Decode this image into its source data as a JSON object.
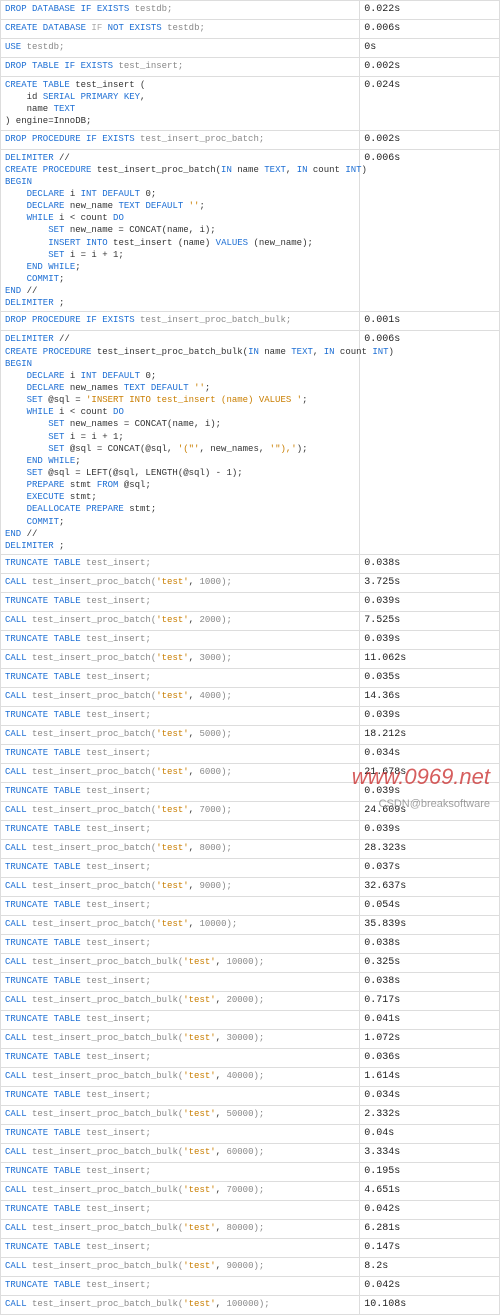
{
  "rows": [
    {
      "sql": "<span class='kw'>DROP DATABASE IF EXISTS</span> <span class='fn'>testdb;</span>",
      "time": "0.022s"
    },
    {
      "sql": "<span class='kw'>CREATE DATABASE</span> <span class='cm'>IF</span> <span class='kw'>NOT EXISTS</span> <span class='fn'>testdb;</span>",
      "time": "0.006s"
    },
    {
      "sql": "<span class='kw'>USE</span> <span class='fn'>testdb;</span>",
      "time": "0s"
    },
    {
      "sql": "<span class='kw'>DROP TABLE IF EXISTS</span> <span class='fn'>test_insert;</span>",
      "time": "0.002s"
    },
    {
      "sql": "<pre><span class='kw'>CREATE TABLE</span> test_insert (\n    id <span class='kw'>SERIAL PRIMARY KEY</span>,\n    name <span class='kw'>TEXT</span>\n) engine=InnoDB;</pre>",
      "time": "0.024s"
    },
    {
      "sql": "<span class='kw'>DROP PROCEDURE IF EXISTS</span> <span class='fn'>test_insert_proc_batch;</span>",
      "time": "0.002s"
    },
    {
      "sql": "<pre><span class='kw'>DELIMITER</span> //\n<span class='kw'>CREATE PROCEDURE</span> test_insert_proc_batch(<span class='kw'>IN</span> name <span class='kw'>TEXT</span>, <span class='kw'>IN</span> count <span class='kw'>INT</span>)\n<span class='kw'>BEGIN</span>\n    <span class='kw'>DECLARE</span> i <span class='kw'>INT DEFAULT</span> 0;\n    <span class='kw'>DECLARE</span> new_name <span class='kw'>TEXT DEFAULT</span> <span class='lit'>''</span>;\n    <span class='kw'>WHILE</span> i &lt; count <span class='kw'>DO</span>\n        <span class='kw'>SET</span> new_name = CONCAT(name, i);\n        <span class='kw'>INSERT INTO</span> test_insert (name) <span class='kw'>VALUES</span> (new_name);\n        <span class='kw'>SET</span> i = i + 1;\n    <span class='kw'>END WHILE</span>;\n    <span class='kw'>COMMIT</span>;\n<span class='kw'>END</span> //\n<span class='kw'>DELIMITER</span> ;</pre>",
      "time": "0.006s"
    },
    {
      "sql": "<span class='kw'>DROP PROCEDURE IF EXISTS</span> <span class='fn'>test_insert_proc_batch_bulk;</span>",
      "time": "0.001s"
    },
    {
      "sql": "<pre><span class='kw'>DELIMITER</span> //\n<span class='kw'>CREATE PROCEDURE</span> test_insert_proc_batch_bulk(<span class='kw'>IN</span> name <span class='kw'>TEXT</span>, <span class='kw'>IN</span> count <span class='kw'>INT</span>)\n<span class='kw'>BEGIN</span>\n    <span class='kw'>DECLARE</span> i <span class='kw'>INT DEFAULT</span> 0;\n    <span class='kw'>DECLARE</span> new_names <span class='kw'>TEXT DEFAULT</span> <span class='lit'>''</span>;\n    <span class='kw'>SET</span> @sql = <span class='lit'>'INSERT INTO test_insert (name) VALUES '</span>;\n    <span class='kw'>WHILE</span> i &lt; count <span class='kw'>DO</span>\n        <span class='kw'>SET</span> new_names = CONCAT(name, i);\n        <span class='kw'>SET</span> i = i + 1;\n        <span class='kw'>SET</span> @sql = CONCAT(@sql, <span class='lit'>'(\"'</span>, new_names, <span class='lit'>'\"),'</span>);\n    <span class='kw'>END WHILE</span>;\n    <span class='kw'>SET</span> @sql = LEFT(@sql, LENGTH(@sql) - 1);\n    <span class='kw'>PREPARE</span> stmt <span class='kw'>FROM</span> @sql;\n    <span class='kw'>EXECUTE</span> stmt;\n    <span class='kw'>DEALLOCATE PREPARE</span> stmt;\n    <span class='kw'>COMMIT</span>;\n<span class='kw'>END</span> //\n<span class='kw'>DELIMITER</span> ;</pre>",
      "time": "0.006s"
    },
    {
      "sql": "<span class='kw'>TRUNCATE TABLE</span> <span class='fn'>test_insert;</span>",
      "time": "0.038s"
    },
    {
      "sql": "<span class='kw'>CALL</span> <span class='fn'>test_insert_proc_batch(</span><span class='lit'>'test'</span>, <span class='fn'>1000);</span>",
      "time": "3.725s"
    },
    {
      "sql": "<span class='kw'>TRUNCATE TABLE</span> <span class='fn'>test_insert;</span>",
      "time": "0.039s"
    },
    {
      "sql": "<span class='kw'>CALL</span> <span class='fn'>test_insert_proc_batch(</span><span class='lit'>'test'</span>, <span class='fn'>2000);</span>",
      "time": "7.525s"
    },
    {
      "sql": "<span class='kw'>TRUNCATE TABLE</span> <span class='fn'>test_insert;</span>",
      "time": "0.039s"
    },
    {
      "sql": "<span class='kw'>CALL</span> <span class='fn'>test_insert_proc_batch(</span><span class='lit'>'test'</span>, <span class='fn'>3000);</span>",
      "time": "11.062s"
    },
    {
      "sql": "<span class='kw'>TRUNCATE TABLE</span> <span class='fn'>test_insert;</span>",
      "time": "0.035s"
    },
    {
      "sql": "<span class='kw'>CALL</span> <span class='fn'>test_insert_proc_batch(</span><span class='lit'>'test'</span>, <span class='fn'>4000);</span>",
      "time": "14.36s"
    },
    {
      "sql": "<span class='kw'>TRUNCATE TABLE</span> <span class='fn'>test_insert;</span>",
      "time": "0.039s"
    },
    {
      "sql": "<span class='kw'>CALL</span> <span class='fn'>test_insert_proc_batch(</span><span class='lit'>'test'</span>, <span class='fn'>5000);</span>",
      "time": "18.212s"
    },
    {
      "sql": "<span class='kw'>TRUNCATE TABLE</span> <span class='fn'>test_insert;</span>",
      "time": "0.034s"
    },
    {
      "sql": "<span class='kw'>CALL</span> <span class='fn'>test_insert_proc_batch(</span><span class='lit'>'test'</span>, <span class='fn'>6000);</span>",
      "time": "21.678s"
    },
    {
      "sql": "<span class='kw'>TRUNCATE TABLE</span> <span class='fn'>test_insert;</span>",
      "time": "0.039s"
    },
    {
      "sql": "<span class='kw'>CALL</span> <span class='fn'>test_insert_proc_batch(</span><span class='lit'>'test'</span>, <span class='fn'>7000);</span>",
      "time": "24.609s"
    },
    {
      "sql": "<span class='kw'>TRUNCATE TABLE</span> <span class='fn'>test_insert;</span>",
      "time": "0.039s"
    },
    {
      "sql": "<span class='kw'>CALL</span> <span class='fn'>test_insert_proc_batch(</span><span class='lit'>'test'</span>, <span class='fn'>8000);</span>",
      "time": "28.323s"
    },
    {
      "sql": "<span class='kw'>TRUNCATE TABLE</span> <span class='fn'>test_insert;</span>",
      "time": "0.037s"
    },
    {
      "sql": "<span class='kw'>CALL</span> <span class='fn'>test_insert_proc_batch(</span><span class='lit'>'test'</span>, <span class='fn'>9000);</span>",
      "time": "32.637s"
    },
    {
      "sql": "<span class='kw'>TRUNCATE TABLE</span> <span class='fn'>test_insert;</span>",
      "time": "0.054s"
    },
    {
      "sql": "<span class='kw'>CALL</span> <span class='fn'>test_insert_proc_batch(</span><span class='lit'>'test'</span>, <span class='fn'>10000);</span>",
      "time": "35.839s"
    },
    {
      "sql": "<span class='kw'>TRUNCATE TABLE</span> <span class='fn'>test_insert;</span>",
      "time": "0.038s"
    },
    {
      "sql": "<span class='kw'>CALL</span> <span class='fn'>test_insert_proc_batch_bulk(</span><span class='lit'>'test'</span>, <span class='fn'>10000);</span>",
      "time": "0.325s"
    },
    {
      "sql": "<span class='kw'>TRUNCATE TABLE</span> <span class='fn'>test_insert;</span>",
      "time": "0.038s"
    },
    {
      "sql": "<span class='kw'>CALL</span> <span class='fn'>test_insert_proc_batch_bulk(</span><span class='lit'>'test'</span>, <span class='fn'>20000);</span>",
      "time": "0.717s"
    },
    {
      "sql": "<span class='kw'>TRUNCATE TABLE</span> <span class='fn'>test_insert;</span>",
      "time": "0.041s"
    },
    {
      "sql": "<span class='kw'>CALL</span> <span class='fn'>test_insert_proc_batch_bulk(</span><span class='lit'>'test'</span>, <span class='fn'>30000);</span>",
      "time": "1.072s"
    },
    {
      "sql": "<span class='kw'>TRUNCATE TABLE</span> <span class='fn'>test_insert;</span>",
      "time": "0.036s"
    },
    {
      "sql": "<span class='kw'>CALL</span> <span class='fn'>test_insert_proc_batch_bulk(</span><span class='lit'>'test'</span>, <span class='fn'>40000);</span>",
      "time": "1.614s"
    },
    {
      "sql": "<span class='kw'>TRUNCATE TABLE</span> <span class='fn'>test_insert;</span>",
      "time": "0.034s"
    },
    {
      "sql": "<span class='kw'>CALL</span> <span class='fn'>test_insert_proc_batch_bulk(</span><span class='lit'>'test'</span>, <span class='fn'>50000);</span>",
      "time": "2.332s"
    },
    {
      "sql": "<span class='kw'>TRUNCATE TABLE</span> <span class='fn'>test_insert;</span>",
      "time": "0.04s"
    },
    {
      "sql": "<span class='kw'>CALL</span> <span class='fn'>test_insert_proc_batch_bulk(</span><span class='lit'>'test'</span>, <span class='fn'>60000);</span>",
      "time": "3.334s"
    },
    {
      "sql": "<span class='kw'>TRUNCATE TABLE</span> <span class='fn'>test_insert;</span>",
      "time": "0.195s"
    },
    {
      "sql": "<span class='kw'>CALL</span> <span class='fn'>test_insert_proc_batch_bulk(</span><span class='lit'>'test'</span>, <span class='fn'>70000);</span>",
      "time": "4.651s"
    },
    {
      "sql": "<span class='kw'>TRUNCATE TABLE</span> <span class='fn'>test_insert;</span>",
      "time": "0.042s"
    },
    {
      "sql": "<span class='kw'>CALL</span> <span class='fn'>test_insert_proc_batch_bulk(</span><span class='lit'>'test'</span>, <span class='fn'>80000);</span>",
      "time": "6.281s"
    },
    {
      "sql": "<span class='kw'>TRUNCATE TABLE</span> <span class='fn'>test_insert;</span>",
      "time": "0.147s"
    },
    {
      "sql": "<span class='kw'>CALL</span> <span class='fn'>test_insert_proc_batch_bulk(</span><span class='lit'>'test'</span>, <span class='fn'>90000);</span>",
      "time": "8.2s"
    },
    {
      "sql": "<span class='kw'>TRUNCATE TABLE</span> <span class='fn'>test_insert;</span>",
      "time": "0.042s"
    },
    {
      "sql": "<span class='kw'>CALL</span> <span class='fn'>test_insert_proc_batch_bulk(</span><span class='lit'>'test'</span>, <span class='fn'>100000);</span>",
      "time": "10.108s"
    }
  ],
  "watermark": "www.0969.net",
  "watermark2": "CSDN@breaksoftware"
}
